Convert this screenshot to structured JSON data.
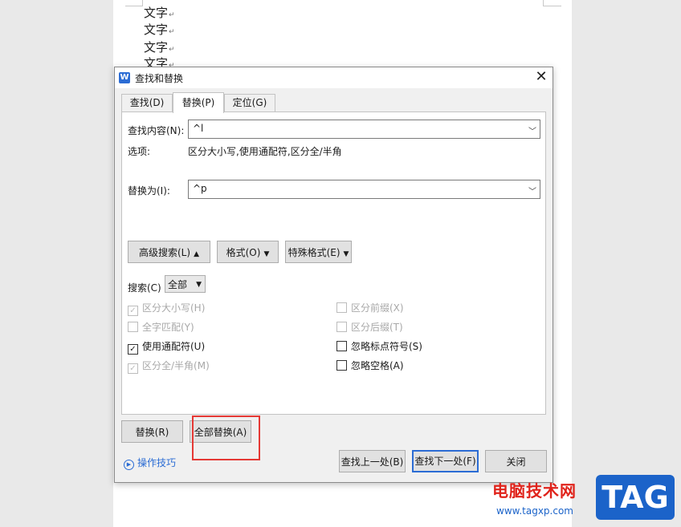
{
  "document": {
    "lines": [
      "文字",
      "文字",
      "文字",
      "文字"
    ]
  },
  "dialog": {
    "app_icon": "W",
    "title": "查找和替换",
    "close": "✕",
    "tabs": [
      {
        "label": "查找(D)",
        "active": false
      },
      {
        "label": "替换(P)",
        "active": true
      },
      {
        "label": "定位(G)",
        "active": false
      }
    ],
    "find_label": "查找内容(N):",
    "find_value": "^l",
    "options_label": "选项:",
    "options_value": "区分大小写,使用通配符,区分全/半角",
    "replace_label": "替换为(I):",
    "replace_value": "^p",
    "advanced_search": "高级搜索(L)",
    "format": "格式(O)",
    "special_format": "特殊格式(E)",
    "search_label": "搜索(C)",
    "search_scope": "全部",
    "checkboxes": {
      "match_case": {
        "label": "区分大小写(H)",
        "checked": true,
        "enabled": false
      },
      "whole_word": {
        "label": "全字匹配(Y)",
        "checked": false,
        "enabled": false
      },
      "use_wildcards": {
        "label": "使用通配符(U)",
        "checked": true,
        "enabled": true
      },
      "match_width": {
        "label": "区分全/半角(M)",
        "checked": true,
        "enabled": false
      },
      "match_prefix": {
        "label": "区分前缀(X)",
        "checked": false,
        "enabled": false
      },
      "match_suffix": {
        "label": "区分后缀(T)",
        "checked": false,
        "enabled": false
      },
      "ignore_punct": {
        "label": "忽略标点符号(S)",
        "checked": false,
        "enabled": true
      },
      "ignore_space": {
        "label": "忽略空格(A)",
        "checked": false,
        "enabled": true
      }
    },
    "replace_button": "替换(R)",
    "replace_all_button": "全部替换(A)",
    "tips_link": "操作技巧",
    "find_prev_button": "查找上一处(B)",
    "find_next_button": "查找下一处(F)",
    "close_button": "关闭"
  },
  "watermark": {
    "site_name": "电脑技术网",
    "url": "www.tagxp.com",
    "logo": "TAG"
  },
  "colors": {
    "accent": "#2b6cd4",
    "highlight": "#e53935"
  }
}
